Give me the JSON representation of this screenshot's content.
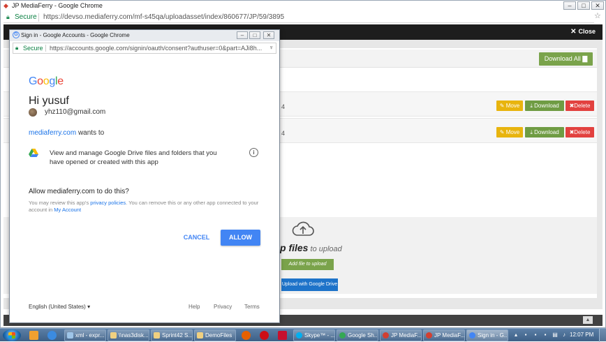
{
  "window": {
    "title": "JP MediaFerry - Google Chrome",
    "secure_label": "Secure",
    "url": "https://devso.mediaferry.com/mf-s45qa/uploadasset/index/860677/JP/59/3895"
  },
  "site": {
    "close_label": "Close",
    "download_all_label": "Download All",
    "rows": [
      {
        "text": "4",
        "move": "Move",
        "download": "Download",
        "delete": "Delete"
      },
      {
        "text": "4",
        "move": "Move",
        "download": "Download",
        "delete": "Delete"
      }
    ],
    "drop_bold": "p files",
    "drop_rest": " to upload",
    "add_file_label": "Add file to upload",
    "gdrive_label": "Upload with Google Drive"
  },
  "popup": {
    "title": "Sign in - Google Accounts - Google Chrome",
    "secure_label": "Secure",
    "url": "https://accounts.google.com/signin/oauth/consent?authuser=0&part=AJi8h...",
    "logo_letters": [
      "G",
      "o",
      "o",
      "g",
      "l",
      "e"
    ],
    "greeting": "Hi yusuf",
    "email": "yhz110@gmail.com",
    "app_name": "mediaferry.com",
    "wants_suffix": " wants to",
    "scope_text": "View and manage Google Drive files and folders that you have opened or created with this app",
    "allow_question": "Allow mediaferry.com to do this?",
    "fine_1": "You may review this app's ",
    "fine_link_1": "privacy policies",
    "fine_2": ". You can remove this or any other app connected to your account in ",
    "fine_link_2": "My Account",
    "cancel_label": "CANCEL",
    "allow_label": "ALLOW",
    "language": "English (United States)",
    "help": "Help",
    "privacy": "Privacy",
    "terms": "Terms"
  },
  "taskbar": {
    "items": [
      {
        "label": "xml - expr...",
        "color": "#9ec5e8"
      },
      {
        "label": "\\\\nas3disk...",
        "color": "#f0d080"
      },
      {
        "label": "Sprint42 S...",
        "color": "#f0d080"
      },
      {
        "label": "DemoFiles",
        "color": "#f0d080"
      },
      {
        "label": "Skype™ - ...",
        "color": "#00aff0"
      },
      {
        "label": "Google Sh...",
        "color": "#34a853"
      },
      {
        "label": "JP MediaF...",
        "color": "#d23f31"
      },
      {
        "label": "JP MediaF...",
        "color": "#d23f31"
      },
      {
        "label": "Sign in - G...",
        "color": "#4285f4"
      }
    ],
    "clock": "12:07 PM"
  }
}
